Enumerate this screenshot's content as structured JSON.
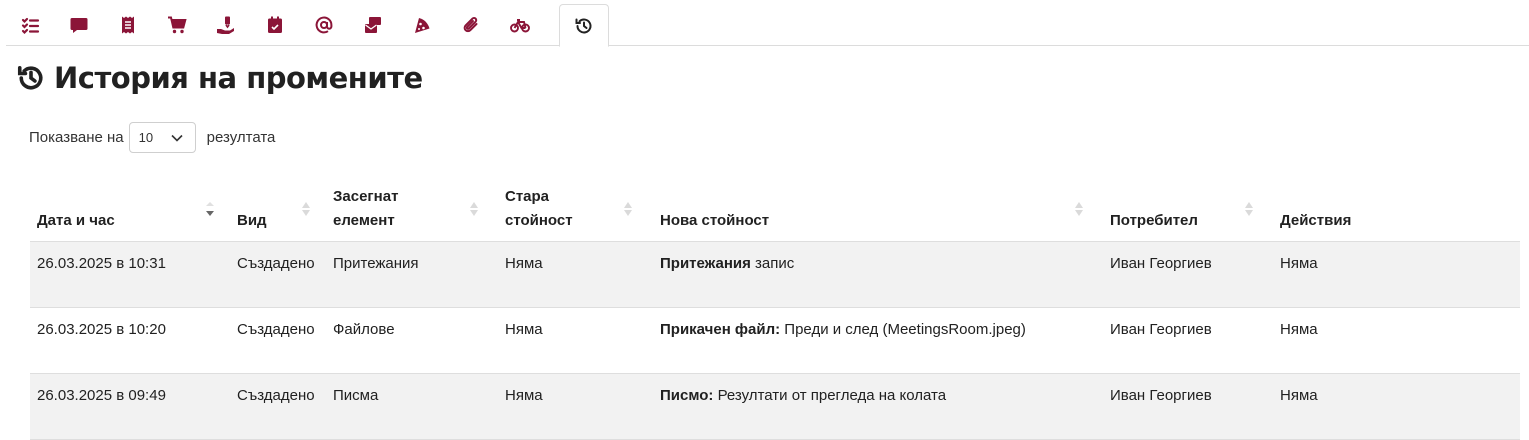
{
  "colors": {
    "accent": "#8b1538",
    "text": "#212121"
  },
  "tabs": [
    {
      "icon": "checklist-icon",
      "active": false
    },
    {
      "icon": "chat-bubble-icon",
      "active": false
    },
    {
      "icon": "receipt-icon",
      "active": false
    },
    {
      "icon": "shopping-cart-icon",
      "active": false
    },
    {
      "icon": "hand-money-icon",
      "active": false
    },
    {
      "icon": "calendar-icon",
      "active": false
    },
    {
      "icon": "at-sign-icon",
      "active": false
    },
    {
      "icon": "mail-bulk-icon",
      "active": false
    },
    {
      "icon": "pizza-slice-icon",
      "active": false
    },
    {
      "icon": "paperclip-icon",
      "active": false
    },
    {
      "icon": "bicycle-icon",
      "active": false
    },
    {
      "icon": "history-icon",
      "active": true
    }
  ],
  "page": {
    "title": "История на промените",
    "title_icon": "history-icon"
  },
  "length_control": {
    "prefix": "Показване на",
    "value": "10",
    "suffix": "резултата"
  },
  "table": {
    "headers": {
      "datetime": "Дата и час",
      "type": "Вид",
      "element_line1": "Засегнат",
      "element_line2": "елемент",
      "old_line1": "Стара",
      "old_line2": "стойност",
      "new_value": "Нова стойност",
      "user": "Потребител",
      "actions": "Действия"
    },
    "rows": [
      {
        "datetime": "26.03.2025 в 10:31",
        "type": "Създадено",
        "element": "Притежания",
        "old_value": "Няма",
        "new_value_bold": "Притежания",
        "new_value_rest": " запис",
        "user": "Иван Георгиев",
        "actions": "Няма"
      },
      {
        "datetime": "26.03.2025 в 10:20",
        "type": "Създадено",
        "element": "Файлове",
        "old_value": "Няма",
        "new_value_bold": "Прикачен файл:",
        "new_value_rest": " Преди и след (MeetingsRoom.jpeg)",
        "user": "Иван Георгиев",
        "actions": "Няма"
      },
      {
        "datetime": "26.03.2025 в 09:49",
        "type": "Създадено",
        "element": "Писма",
        "old_value": "Няма",
        "new_value_bold": "Писмо:",
        "new_value_rest": " Резултати от прегледа на колата",
        "user": "Иван Георгиев",
        "actions": "Няма"
      }
    ]
  }
}
